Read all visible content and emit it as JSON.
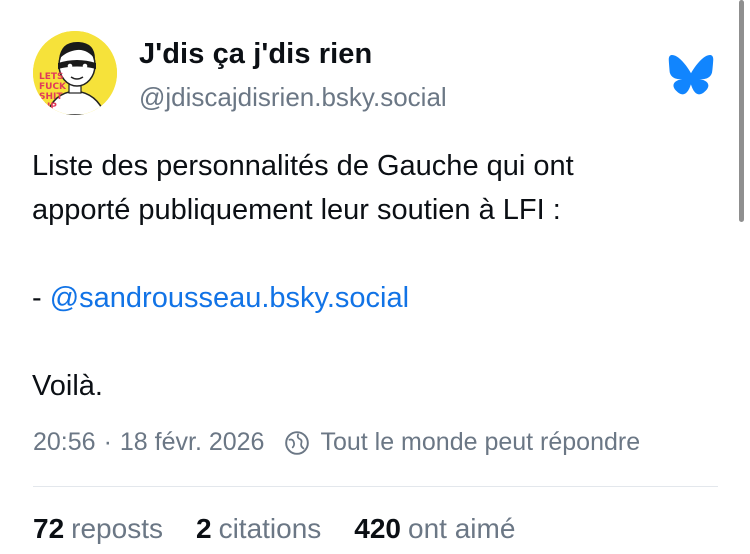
{
  "author": {
    "display_name": "J'dis ça j'dis rien",
    "handle": "@jdiscajdisrien.bsky.social",
    "avatar_text": "LETS FUCK SHIT UP"
  },
  "post": {
    "line1": "Liste des personnalités de Gauche qui ont",
    "line2": "apporté publiquement leur soutien à LFI :",
    "mention_prefix": "- ",
    "mention": "@sandrousseau.bsky.social",
    "closing": "Voilà."
  },
  "meta": {
    "time": "20:56",
    "separator": "·",
    "date": "18 févr. 2026",
    "reply_setting": "Tout le monde peut répondre"
  },
  "stats": {
    "reposts_count": "72",
    "reposts_label": "reposts",
    "quotes_count": "2",
    "quotes_label": "citations",
    "likes_count": "420",
    "likes_label": "ont aimé"
  },
  "icons": {
    "logo": "butterfly-icon",
    "reply_setting": "globe-icon"
  },
  "colors": {
    "link": "#1173e6",
    "muted": "#6b7785",
    "logo": "#1185fe",
    "avatar_bg": "#f6e23a"
  }
}
